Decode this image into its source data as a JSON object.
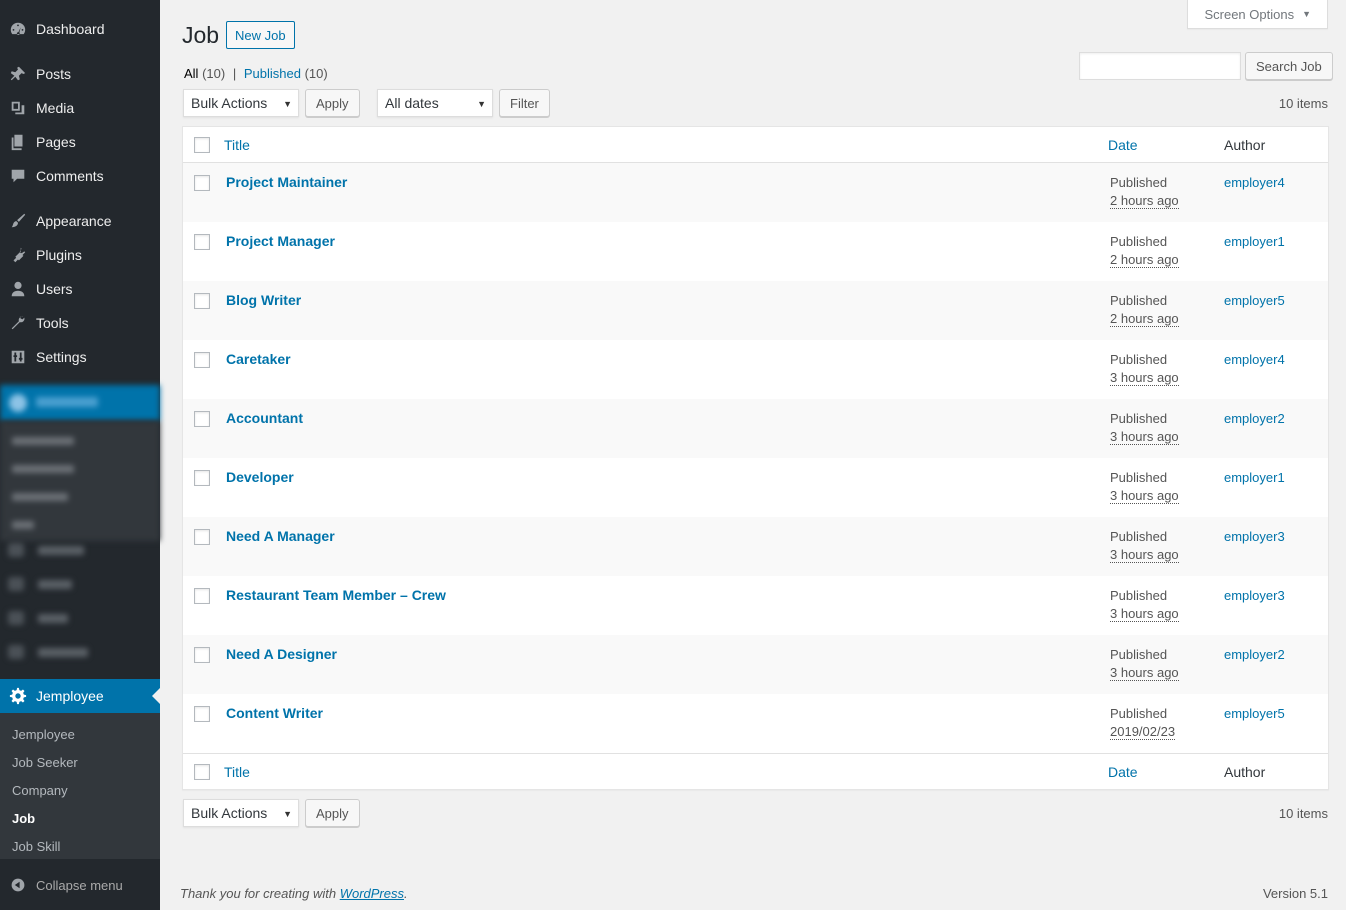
{
  "sidebar": {
    "items": [
      {
        "label": "Dashboard",
        "icon": "dashboard-icon"
      },
      {
        "label": "Posts",
        "icon": "pin-icon"
      },
      {
        "label": "Media",
        "icon": "media-icon"
      },
      {
        "label": "Pages",
        "icon": "pages-icon"
      },
      {
        "label": "Comments",
        "icon": "comment-icon"
      },
      {
        "label": "Appearance",
        "icon": "brush-icon"
      },
      {
        "label": "Plugins",
        "icon": "plug-icon"
      },
      {
        "label": "Users",
        "icon": "user-icon"
      },
      {
        "label": "Tools",
        "icon": "wrench-icon"
      },
      {
        "label": "Settings",
        "icon": "settings-icon"
      }
    ],
    "active": {
      "label": "Jemployee",
      "icon": "gear-icon"
    },
    "submenu": [
      "Jemployee",
      "Job Seeker",
      "Company",
      "Job",
      "Job Skill"
    ],
    "current_sub": "Job",
    "collapse": "Collapse menu"
  },
  "header": {
    "screen_options": "Screen Options",
    "title": "Job",
    "new_job": "New Job"
  },
  "filters": {
    "all_label": "All",
    "all_count": "(10)",
    "sep": "|",
    "published_label": "Published",
    "published_count": "(10)",
    "search_button": "Search Job",
    "bulk_actions": "Bulk Actions",
    "apply": "Apply",
    "dates": "All dates",
    "filter": "Filter",
    "items_count": "10 items"
  },
  "table": {
    "columns": {
      "title": "Title",
      "date": "Date",
      "author": "Author"
    },
    "rows": [
      {
        "title": "Project Maintainer",
        "status": "Published",
        "time": "2 hours ago",
        "author": "employer4"
      },
      {
        "title": "Project Manager",
        "status": "Published",
        "time": "2 hours ago",
        "author": "employer1"
      },
      {
        "title": "Blog Writer",
        "status": "Published",
        "time": "2 hours ago",
        "author": "employer5"
      },
      {
        "title": "Caretaker",
        "status": "Published",
        "time": "3 hours ago",
        "author": "employer4"
      },
      {
        "title": "Accountant",
        "status": "Published",
        "time": "3 hours ago",
        "author": "employer2"
      },
      {
        "title": "Developer",
        "status": "Published",
        "time": "3 hours ago",
        "author": "employer1"
      },
      {
        "title": "Need A Manager",
        "status": "Published",
        "time": "3 hours ago",
        "author": "employer3"
      },
      {
        "title": "Restaurant Team Member – Crew",
        "status": "Published",
        "time": "3 hours ago",
        "author": "employer3"
      },
      {
        "title": "Need A Designer",
        "status": "Published",
        "time": "3 hours ago",
        "author": "employer2"
      },
      {
        "title": "Content Writer",
        "status": "Published",
        "time": "2019/02/23",
        "author": "employer5"
      }
    ]
  },
  "footer": {
    "thanks_prefix": "Thank you for creating with ",
    "wordpress": "WordPress",
    "thanks_suffix": ".",
    "version": "Version 5.1"
  },
  "colors": {
    "sidebar_bg": "#23282d",
    "accent": "#0073aa",
    "page_bg": "#f1f1f1"
  }
}
